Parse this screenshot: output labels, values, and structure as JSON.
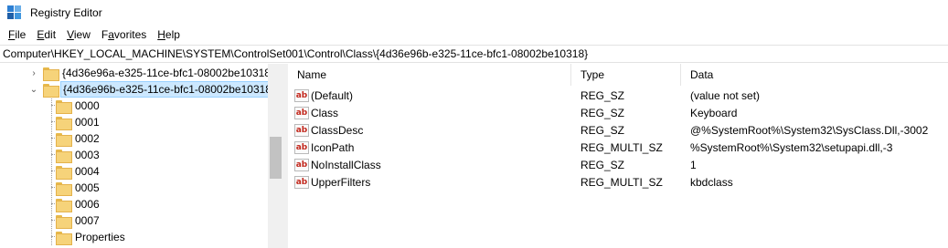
{
  "window": {
    "title": "Registry Editor",
    "icon": "registry-editor-icon"
  },
  "menu": [
    {
      "label": "File",
      "key": "F",
      "rest": "ile"
    },
    {
      "label": "Edit",
      "key": "E",
      "rest": "dit"
    },
    {
      "label": "View",
      "key": "V",
      "rest": "iew"
    },
    {
      "label": "Favorites",
      "key": "a",
      "pre": "F",
      "rest": "vorites"
    },
    {
      "label": "Help",
      "key": "H",
      "rest": "elp"
    }
  ],
  "address": "Computer\\HKEY_LOCAL_MACHINE\\SYSTEM\\ControlSet001\\Control\\Class\\{4d36e96b-e325-11ce-bfc1-08002be10318}",
  "tree": {
    "sibling": {
      "label": "{4d36e96a-e325-11ce-bfc1-08002be10318}",
      "expander": "›"
    },
    "selected": {
      "label": "{4d36e96b-e325-11ce-bfc1-08002be10318}",
      "expander": "⌄"
    },
    "children": [
      "0000",
      "0001",
      "0002",
      "0003",
      "0004",
      "0005",
      "0006",
      "0007",
      "Properties"
    ]
  },
  "list": {
    "headers": {
      "name": "Name",
      "type": "Type",
      "data": "Data"
    },
    "rows": [
      {
        "name": "(Default)",
        "type": "REG_SZ",
        "data": "(value not set)"
      },
      {
        "name": "Class",
        "type": "REG_SZ",
        "data": "Keyboard"
      },
      {
        "name": "ClassDesc",
        "type": "REG_SZ",
        "data": "@%SystemRoot%\\System32\\SysClass.Dll,-3002"
      },
      {
        "name": "IconPath",
        "type": "REG_MULTI_SZ",
        "data": "%SystemRoot%\\System32\\setupapi.dll,-3"
      },
      {
        "name": "NoInstallClass",
        "type": "REG_SZ",
        "data": "1"
      },
      {
        "name": "UpperFilters",
        "type": "REG_MULTI_SZ",
        "data": "kbdclass"
      }
    ],
    "value_icon_text": "ab"
  }
}
